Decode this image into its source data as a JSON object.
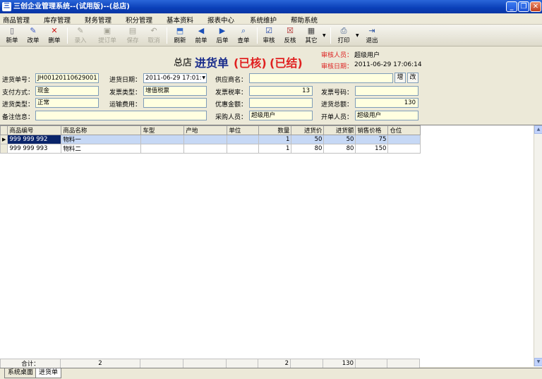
{
  "window": {
    "title": "三创企业管理系统--(试用版)--(总店)"
  },
  "menu": [
    "商品管理",
    "库存管理",
    "财务管理",
    "积分管理",
    "基本资料",
    "报表中心",
    "系统维护",
    "帮助系统"
  ],
  "toolbar": {
    "new": "新单",
    "edit": "改单",
    "delete": "删单",
    "import": "录入",
    "order": "提订单",
    "save": "保存",
    "cancel": "取消",
    "refresh": "刷新",
    "prev": "前单",
    "next": "后单",
    "search": "查单",
    "audit": "审核",
    "unaudit": "反核",
    "other": "其它",
    "print": "打印",
    "exit": "退出"
  },
  "header": {
    "store": "总店",
    "title": "进货单",
    "status1": "(已核)",
    "status2": "(已结)",
    "auditor_label": "审核人员：",
    "auditor": "超级用户",
    "audit_date_label": "审核日期：",
    "audit_date": "2011-06-29 17:06:14"
  },
  "form": {
    "doc_no_label": "进货单号：",
    "doc_no": "JH00120110629001",
    "date_label": "进货日期：",
    "date": "2011-06-29 17:01:",
    "supplier_label": "供应商名：",
    "supplier": "",
    "add_btn": "增",
    "edit_btn": "改",
    "pay_label": "支付方式：",
    "pay": "现金",
    "invoice_type_label": "发票类型：",
    "invoice_type": "增值税票",
    "tax_label": "发票税率：",
    "tax": "13",
    "invoice_no_label": "发票号码：",
    "invoice_no": "",
    "type_label": "进货类型：",
    "type": "正常",
    "freight_label": "运输费用：",
    "freight": "",
    "discount_label": "优惠金额：",
    "discount": "",
    "total_label": "进货总额：",
    "total": "130",
    "remark_label": "备注信息：",
    "remark": "",
    "buyer_label": "采购人员：",
    "buyer": "超级用户",
    "maker_label": "开单人员：",
    "maker": "超级用户"
  },
  "table": {
    "columns": [
      "商品编号",
      "商品名称",
      "车型",
      "产地",
      "单位",
      "数量",
      "进货价",
      "进货额",
      "销售价格",
      "仓位"
    ],
    "rows": [
      [
        "999 999 992",
        "物料一",
        "",
        "",
        "",
        "1",
        "50",
        "50",
        "75",
        ""
      ],
      [
        "999 999 993",
        "物料二",
        "",
        "",
        "",
        "1",
        "80",
        "80",
        "150",
        ""
      ]
    ],
    "footer": {
      "label": "合计：",
      "count": "2",
      "qty": "2",
      "amount": "130"
    }
  },
  "tabs": [
    "系统桌面",
    "进货单"
  ]
}
